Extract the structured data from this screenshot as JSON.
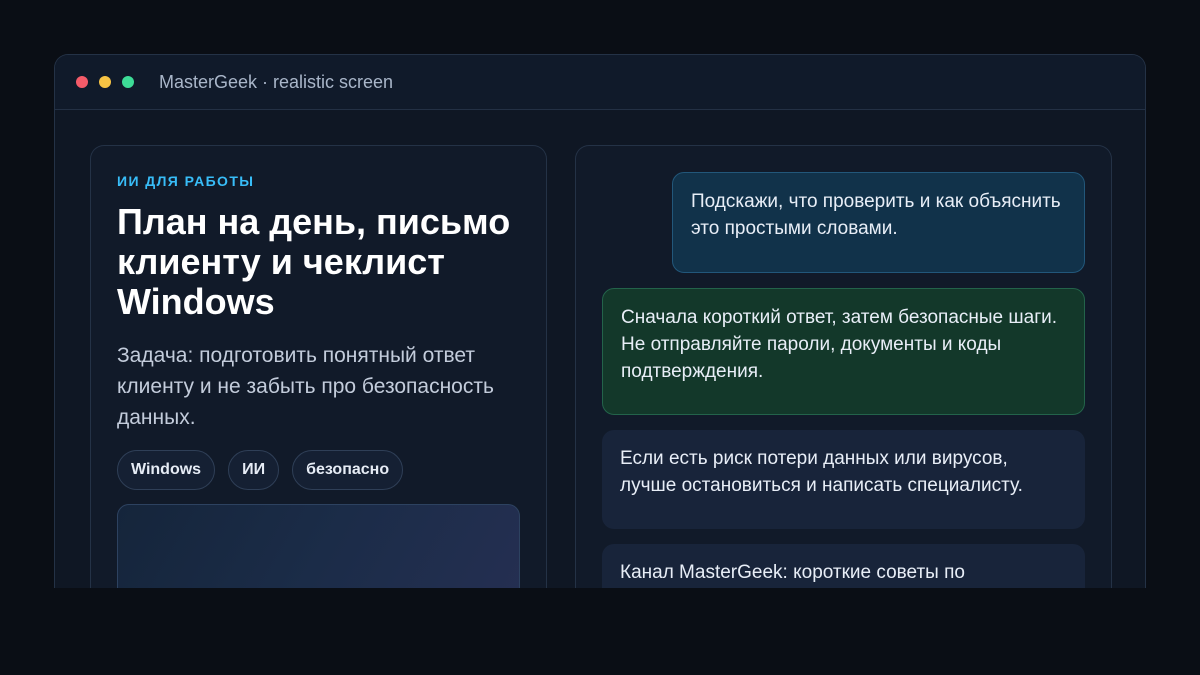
{
  "window": {
    "title": "MasterGeek · realistic screen"
  },
  "left": {
    "kicker": "ИИ ДЛЯ РАБОТЫ",
    "headline": "План на день, письмо клиенту и чеклист Windows",
    "description": "Задача: подготовить понятный ответ клиенту и не забыть про безопасность данных.",
    "tags": [
      "Windows",
      "ИИ",
      "безопасно"
    ]
  },
  "chat": {
    "messages": [
      "Подскажи, что проверить и как объяснить это простыми словами.",
      "Сначала короткий ответ, затем безопасные шаги. Не отправляйте пароли, документы и коды подтверждения.",
      "Если есть риск потери данных или вирусов, лучше остановиться и написать специалисту.",
      "Канал MasterGeek: короткие советы по"
    ]
  },
  "colors": {
    "background": "#0a0e15",
    "accent": "#38bdf8",
    "user_bubble": "#11324a",
    "assistant_bubble": "#13382a",
    "dot_red": "#f45b69",
    "dot_yellow": "#f6c344",
    "dot_green": "#3ddc97"
  }
}
